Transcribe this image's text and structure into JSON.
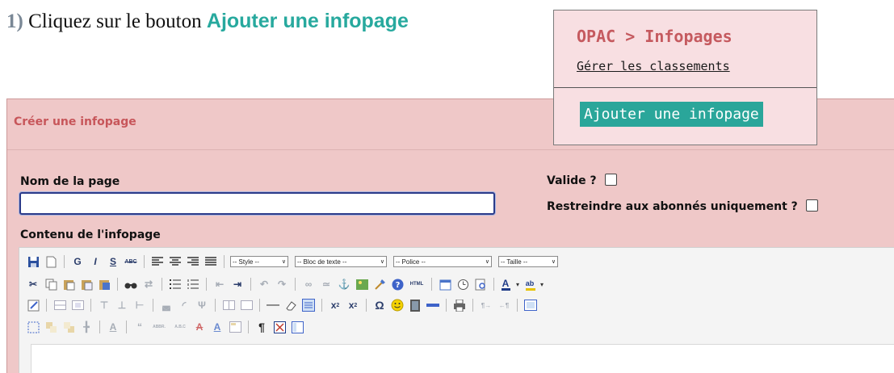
{
  "instruction": {
    "number": "1)",
    "text": " Cliquez sur le bouton ",
    "highlight": "Ajouter une infopage"
  },
  "popup": {
    "title": "OPAC > Infopages",
    "link": "Gérer les classements",
    "button": "Ajouter une infopage"
  },
  "form": {
    "title": "Créer une infopage",
    "name_label": "Nom de la page",
    "name_value": "",
    "content_label": "Contenu de l'infopage",
    "valid_label": "Valide ?",
    "restrict_label": "Restreindre aux abonnés uniquement ?"
  },
  "toolbar": {
    "bold": "G",
    "italic": "I",
    "underline": "S",
    "strike": "ABC",
    "style_select": "-- Style --",
    "block_select": "-- Bloc de texte --",
    "font_select": "-- Police --",
    "size_select": "-- Taille --",
    "html_label": "HTML",
    "special_char": "Ω",
    "pilcrow": "¶",
    "icons": [
      "save-icon",
      "new-document-icon",
      "cut-icon",
      "copy-icon",
      "paste-icon",
      "paste-text-icon",
      "paste-word-icon",
      "find-icon",
      "replace-icon",
      "bullet-list-icon",
      "numbered-list-icon",
      "outdent-icon",
      "indent-icon",
      "undo-icon",
      "redo-icon",
      "link-icon",
      "unlink-icon",
      "anchor-icon",
      "image-icon",
      "cleanup-icon",
      "help-icon",
      "insert-date-icon",
      "insert-time-icon",
      "preview-icon",
      "text-color-icon",
      "highlight-color-icon",
      "table-icon",
      "horizontal-rule-icon",
      "remove-format-icon",
      "visual-aid-icon",
      "subscript-icon",
      "superscript-icon",
      "emoticon-icon",
      "media-icon",
      "print-icon",
      "fullscreen-icon",
      "layer-icon",
      "citation-icon",
      "show-blocks-icon",
      "template-icon"
    ]
  }
}
